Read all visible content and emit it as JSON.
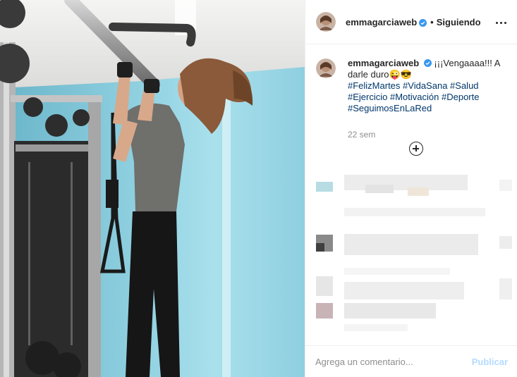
{
  "header": {
    "username": "emmagarciaweb",
    "separator": "•",
    "follow_status": "Siguiendo"
  },
  "caption": {
    "username": "emmagarciaweb",
    "text": "¡¡¡Vengaaaa!!! A darle duro😜😎",
    "hashtags": [
      "#FelizMartes",
      "#VidaSana",
      "#Salud",
      "#Ejercicio",
      "#Motivación",
      "#Deporte",
      "#SeguimosEnLaRed"
    ],
    "time": "22 sem"
  },
  "comment_box": {
    "placeholder": "Agrega un comentario...",
    "publish_label": "Publicar"
  },
  "icons": {
    "verified": "verified-badge-icon",
    "more": "more-options-icon",
    "load_more": "plus-circle-icon"
  },
  "colors": {
    "link": "#00376b",
    "verified": "#3897f0",
    "muted": "#8e8e8e",
    "publish_disabled": "#b3dbff"
  }
}
